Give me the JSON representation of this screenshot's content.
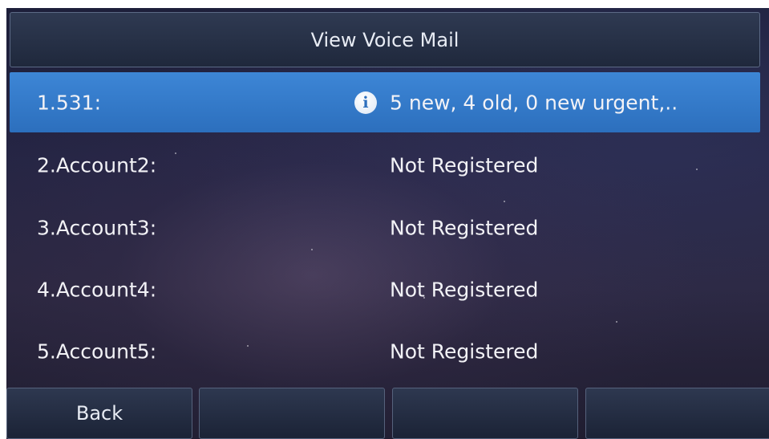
{
  "header": {
    "title": "View Voice Mail"
  },
  "accounts": [
    {
      "label": "1.531:",
      "status": "5 new, 4 old, 0 new urgent,..",
      "icon": "info-icon",
      "selected": true
    },
    {
      "label": "2.Account2:",
      "status": "Not Registered",
      "selected": false
    },
    {
      "label": "3.Account3:",
      "status": "Not Registered",
      "selected": false
    },
    {
      "label": "4.Account4:",
      "status": "Not Registered",
      "selected": false
    },
    {
      "label": "5.Account5:",
      "status": "Not Registered",
      "selected": false
    }
  ],
  "softkeys": [
    {
      "label": "Back"
    },
    {
      "label": ""
    },
    {
      "label": ""
    },
    {
      "label": ""
    }
  ],
  "colors": {
    "selected_row": "#3179c9",
    "background": "#22223d",
    "text": "#f2f2f6"
  }
}
